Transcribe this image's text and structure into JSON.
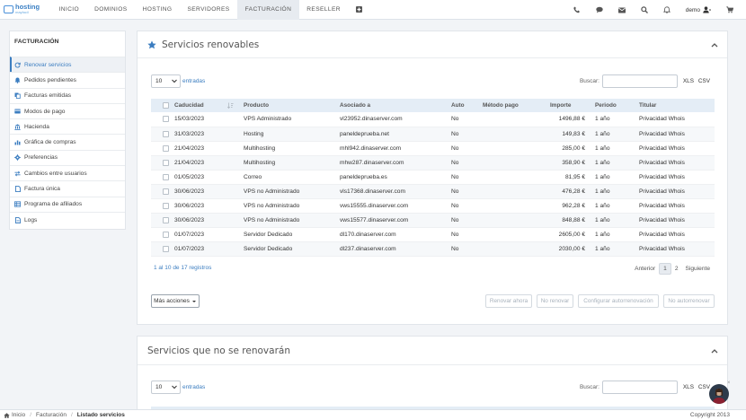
{
  "brand": {
    "name": "hosting",
    "sub": "mayfacil"
  },
  "nav": {
    "items": [
      "INICIO",
      "DOMINIOS",
      "HOSTING",
      "SERVIDORES",
      "FACTURACIÓN",
      "RESELLER"
    ],
    "active": "FACTURACIÓN",
    "user": "demo"
  },
  "sidebar": {
    "title": "FACTURACIÓN",
    "items": [
      {
        "label": "Renovar servicios",
        "icon": "refresh-icon"
      },
      {
        "label": "Pedidos pendientes",
        "icon": "bell-icon"
      },
      {
        "label": "Facturas emitidas",
        "icon": "copy-icon"
      },
      {
        "label": "Modos de pago",
        "icon": "credit-card-icon"
      },
      {
        "label": "Hacienda",
        "icon": "bank-icon"
      },
      {
        "label": "Gráfica de compras",
        "icon": "bar-chart-icon"
      },
      {
        "label": "Preferencias",
        "icon": "gear-icon"
      },
      {
        "label": "Cambios entre usuarios",
        "icon": "exchange-icon"
      },
      {
        "label": "Factura única",
        "icon": "file-icon"
      },
      {
        "label": "Programa de afiliados",
        "icon": "table-icon"
      },
      {
        "label": "Logs",
        "icon": "document-icon"
      }
    ]
  },
  "renewable": {
    "title": "Servicios renovables",
    "page_size": "10",
    "entries_label": "entradas",
    "search_label": "Buscar:",
    "search_value": "",
    "xls": "XLS",
    "csv": "CSV",
    "columns": [
      "Caducidad",
      "Producto",
      "Asociado a",
      "Auto",
      "Método pago",
      "Importe",
      "Periodo",
      "Titular"
    ],
    "rows": [
      [
        "15/03/2023",
        "VPS Administrado",
        "vl23952.dinaserver.com",
        "No",
        "",
        "1496,88 €",
        "1 año",
        "Privacidad Whois"
      ],
      [
        "31/03/2023",
        "Hosting",
        "paneldeprueba.net",
        "No",
        "",
        "149,83 €",
        "1 año",
        "Privacidad Whois"
      ],
      [
        "21/04/2023",
        "Multihosting",
        "mhl942.dinaserver.com",
        "No",
        "",
        "285,00 €",
        "1 año",
        "Privacidad Whois"
      ],
      [
        "21/04/2023",
        "Multihosting",
        "mhw287.dinaserver.com",
        "No",
        "",
        "358,90 €",
        "1 año",
        "Privacidad Whois"
      ],
      [
        "01/05/2023",
        "Correo",
        "paneldeprueba.es",
        "No",
        "",
        "81,95 €",
        "1 año",
        "Privacidad Whois"
      ],
      [
        "30/06/2023",
        "VPS no Administrado",
        "vls17368.dinaserver.com",
        "No",
        "",
        "476,28 €",
        "1 año",
        "Privacidad Whois"
      ],
      [
        "30/06/2023",
        "VPS no Administrado",
        "vws15555.dinaserver.com",
        "No",
        "",
        "962,28 €",
        "1 año",
        "Privacidad Whois"
      ],
      [
        "30/06/2023",
        "VPS no Administrado",
        "vws15577.dinaserver.com",
        "No",
        "",
        "848,88 €",
        "1 año",
        "Privacidad Whois"
      ],
      [
        "01/07/2023",
        "Servidor Dedicado",
        "dl170.dinaserver.com",
        "No",
        "",
        "2605,00 €",
        "1 año",
        "Privacidad Whois"
      ],
      [
        "01/07/2023",
        "Servidor Dedicado",
        "dl237.dinaserver.com",
        "No",
        "",
        "2030,00 €",
        "1 año",
        "Privacidad Whois"
      ]
    ],
    "info": "1 al 10 de 17 registros",
    "pager": {
      "prev": "Anterior",
      "pages": [
        "1",
        "2"
      ],
      "current": "1",
      "next": "Siguiente"
    },
    "more_actions": "Más acciones",
    "actions": [
      "Renovar ahora",
      "No renovar",
      "Configurar autorrenovación",
      "No autorrenovar"
    ]
  },
  "nonrenewable": {
    "title": "Servicios que no se renovarán",
    "page_size": "10",
    "entries_label": "entradas",
    "search_label": "Buscar:",
    "xls": "XLS",
    "csv": "CSV"
  },
  "footer": {
    "breadcrumb": [
      "Inicio",
      "Facturación",
      "Listado servicios"
    ],
    "copyright": "Copyright 2013"
  }
}
